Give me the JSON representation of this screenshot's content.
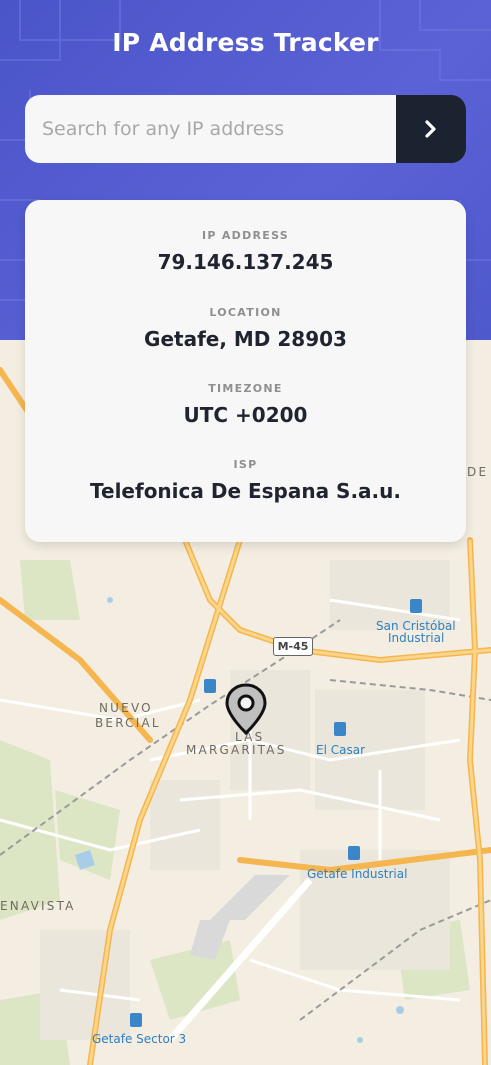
{
  "app": {
    "title": "IP Address Tracker"
  },
  "search": {
    "placeholder": "Search for any IP address",
    "submit_icon": "chevron-right-icon"
  },
  "info": {
    "ip_label": "IP ADDRESS",
    "ip_value": "79.146.137.245",
    "location_label": "LOCATION",
    "location_value": "Getafe, MD 28903",
    "timezone_label": "TIMEZONE",
    "timezone_value": "UTC +0200",
    "isp_label": "ISP",
    "isp_value": "Telefonica De Espana S.a.u."
  },
  "map": {
    "road_sign": "M-45",
    "labels": {
      "nuevo": "NUEVO",
      "bercial": "BERCIAL",
      "las": "LAS",
      "margaritas": "MARGARITAS",
      "el_casar": "El Casar",
      "san_cristobal_1": "San Cristóbal",
      "san_cristobal_2": "Industrial",
      "getafe_industrial": "Getafe Industrial",
      "getafe_sector3": "Getafe Sector 3",
      "navista": "ENAVISTA",
      "de": "DE"
    },
    "marker_icon": "location-pin-icon",
    "station_icon": "train-station-icon"
  },
  "colors": {
    "header": "#5059cc",
    "dark_button": "#1c2330",
    "card": "#f7f7f7",
    "map_bg": "#f4eee2",
    "road": "#f5b64f"
  }
}
